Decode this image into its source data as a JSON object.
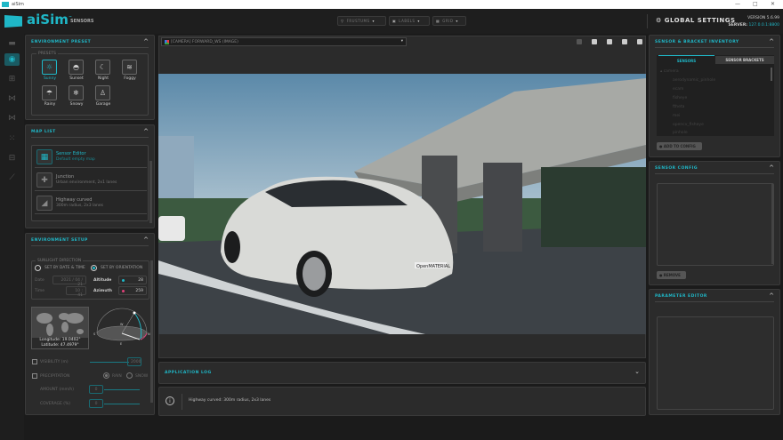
{
  "window": {
    "title": "aiSim",
    "controls": [
      "—",
      "□",
      "✕"
    ]
  },
  "header": {
    "brand": "aiSim",
    "brand_tm": "™",
    "subtitle": "SENSORS",
    "dropdowns": [
      {
        "label": "FRUSTUMS",
        "icon": "frustum-icon"
      },
      {
        "label": "LABELS",
        "icon": "labels-icon"
      },
      {
        "label": "GRID",
        "icon": "grid-icon"
      }
    ],
    "global_settings": "GLOBAL SETTINGS",
    "version": "VERSION 5.6.99",
    "server_label": "SERVER:",
    "server": "127.0.0.1:8800"
  },
  "rail": {
    "icons": [
      "car-icon",
      "sensor-icon",
      "vehicle-setup-icon",
      "scenario-icon",
      "scenario-list-icon",
      "grid-dots-icon",
      "network-icon",
      "chart-icon"
    ],
    "active": 1
  },
  "environment_preset": {
    "title": "ENVIRONMENT PRESET",
    "group": "PRESETS",
    "presets": [
      {
        "label": "Sunny",
        "icon": "☼"
      },
      {
        "label": "Sunset",
        "icon": "◓"
      },
      {
        "label": "Night",
        "icon": "☾"
      },
      {
        "label": "Foggy",
        "icon": "≋"
      },
      {
        "label": "Rainy",
        "icon": "☂"
      },
      {
        "label": "Snowy",
        "icon": "❄"
      },
      {
        "label": "Garage",
        "icon": "♙"
      }
    ],
    "selected": "Sunny"
  },
  "map_list": {
    "title": "MAP LIST",
    "items": [
      {
        "title": "Sensor Editor",
        "subtitle": "Default empty map",
        "icon": "▦",
        "selected": true
      },
      {
        "title": "Junction",
        "subtitle": "Urban environment, 2x1 lanes",
        "icon": "✚"
      },
      {
        "title": "Highway curved",
        "subtitle": "300m radius, 2x3 lanes",
        "icon": "◢"
      }
    ]
  },
  "environment_setup": {
    "title": "ENVIRONMENT SETUP",
    "sunlight": {
      "group": "SUNLIGHT DIRECTION",
      "by_date": "SET BY DATE & TIME",
      "by_orientation": "SET BY ORIENTATION",
      "selected": "orientation",
      "date_label": "Date",
      "date": "2021 / 04 / 21",
      "time_label": "Time",
      "time": "10 : 41",
      "altitude_label": "Altitude",
      "altitude": "28",
      "azimuth_label": "Azimuth",
      "azimuth": "259",
      "altitude_color": "#1fb7c7",
      "azimuth_color": "#e0407a"
    },
    "location": {
      "longitude": "Longitude: 19.0402°",
      "latitude": "Latitude: 47.4979°"
    },
    "compass": {
      "n": "N",
      "e": "E",
      "s": "S",
      "w": "W"
    },
    "visibility": {
      "label": "VISIBILITY (m)",
      "value": "2000",
      "checked": false
    },
    "precipitation": {
      "label": "PRECIPITATION",
      "rain": "RAIN",
      "snow": "SNOW",
      "checked": false,
      "selected": "rain"
    },
    "amount": {
      "label": "AMOUNT (mm/h)",
      "value": "0"
    },
    "coverage": {
      "label": "COVERAGE (%)",
      "value": "0"
    }
  },
  "viewport": {
    "camera": "[CAMERA] FORWARD_WS (IMAGE)",
    "tools": [
      "info-icon",
      "screenshot-icon",
      "fit-icon",
      "frame-icon",
      "fullscreen-icon"
    ],
    "car_plate": "OpenMATERIAL"
  },
  "app_log": {
    "title": "APPLICATION LOG",
    "message": "Highway curved: 300m radius, 2x3 lanes"
  },
  "inventory": {
    "title": "SENSOR & BRACKET INVENTORY",
    "tabs": [
      "SENSORS",
      "SENSOR BRACKETS"
    ],
    "active_tab": 0,
    "tree_root": "camera",
    "items": [
      "aerodynamic_pinhole",
      "ecam",
      "fisheye",
      "ftheta",
      "mei",
      "opencv_fisheye",
      "pinhole"
    ],
    "add": "ADD TO CONFIG"
  },
  "sensor_config": {
    "title": "SENSOR CONFIG",
    "remove": "REMOVE"
  },
  "parameter_editor": {
    "title": "PARAMETER EDITOR"
  },
  "colors": {
    "accent": "#1fb7c7",
    "panel": "#2b2b2b",
    "background": "#1b1b1b"
  }
}
